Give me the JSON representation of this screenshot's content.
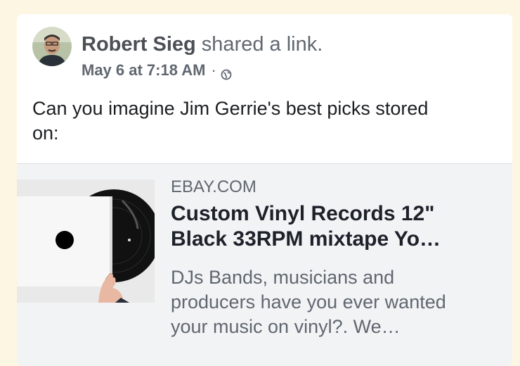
{
  "post": {
    "author": "Robert Sieg",
    "action": " shared a link.",
    "timestamp": "May 6 at 7:18 AM",
    "separator": "·",
    "privacy_icon": "globe-icon",
    "text": "Can you imagine Jim Gerrie's best picks stored on:"
  },
  "link": {
    "domain": "EBAY.COM",
    "title": "Custom Vinyl Records 12\"\nBlack 33RPM mixtape Yo…",
    "description": "DJs Bands, musicians and\nproducers have you ever wanted\nyour music on vinyl?. We…",
    "thumbnail_icon": "vinyl-record-image"
  }
}
